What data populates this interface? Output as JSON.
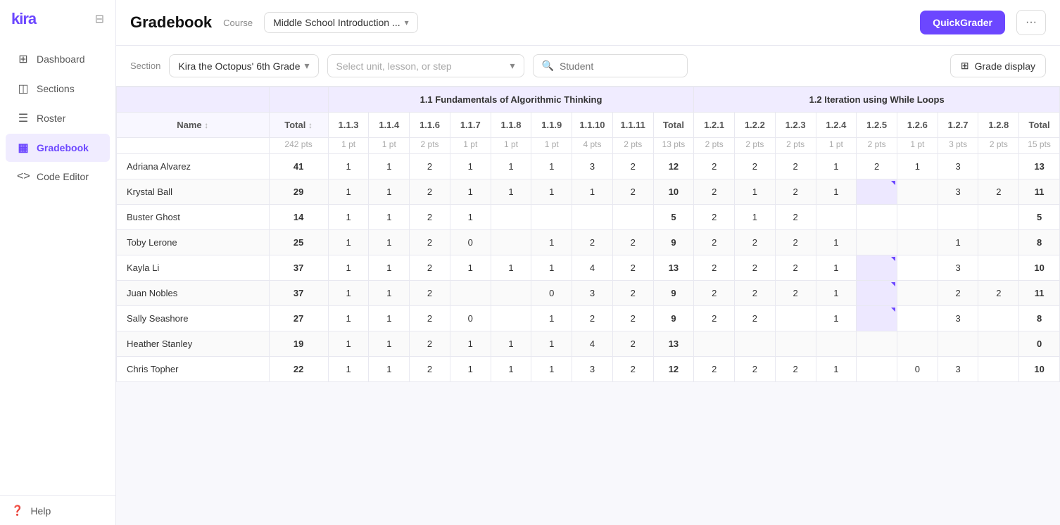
{
  "app": {
    "name": "kira"
  },
  "sidebar": {
    "items": [
      {
        "id": "dashboard",
        "label": "Dashboard",
        "icon": "⊞",
        "active": false
      },
      {
        "id": "sections",
        "label": "Sections",
        "icon": "◫",
        "active": false
      },
      {
        "id": "roster",
        "label": "Roster",
        "icon": "☰",
        "active": false
      },
      {
        "id": "gradebook",
        "label": "Gradebook",
        "icon": "▦",
        "active": true
      },
      {
        "id": "code-editor",
        "label": "Code Editor",
        "icon": "<>",
        "active": false
      }
    ],
    "footer": {
      "label": "Help"
    }
  },
  "header": {
    "title": "Gradebook",
    "course_label": "Course",
    "course_name": "Middle School Introduction ...",
    "quick_grader_label": "QuickGrader",
    "more_label": "···"
  },
  "toolbar": {
    "section_label": "Section",
    "section_name": "Kira the Octopus' 6th Grade",
    "unit_placeholder": "Select unit, lesson, or step",
    "search_placeholder": "Student",
    "grade_display_label": "Grade display"
  },
  "table": {
    "name_col": "Name",
    "total_col": "Total",
    "total_pts": "242 pts",
    "groups": [
      {
        "name": "1.1 Fundamentals of Algorithmic Thinking",
        "cols": [
          {
            "id": "1.1.3",
            "pts": "1 pt"
          },
          {
            "id": "1.1.4",
            "pts": "1 pt"
          },
          {
            "id": "1.1.6",
            "pts": "2 pts"
          },
          {
            "id": "1.1.7",
            "pts": "1 pt"
          },
          {
            "id": "1.1.8",
            "pts": "1 pt"
          },
          {
            "id": "1.1.9",
            "pts": "1 pt"
          },
          {
            "id": "1.1.10",
            "pts": "4 pts"
          },
          {
            "id": "1.1.11",
            "pts": "2 pts"
          },
          {
            "id": "Total",
            "pts": "13 pts"
          }
        ]
      },
      {
        "name": "1.2 Iteration using While Loops",
        "cols": [
          {
            "id": "1.2.1",
            "pts": "2 pts"
          },
          {
            "id": "1.2.2",
            "pts": "2 pts"
          },
          {
            "id": "1.2.3",
            "pts": "2 pts"
          },
          {
            "id": "1.2.4",
            "pts": "1 pt"
          },
          {
            "id": "1.2.5",
            "pts": "2 pts"
          },
          {
            "id": "1.2.6",
            "pts": "1 pt"
          },
          {
            "id": "1.2.7",
            "pts": "3 pts"
          },
          {
            "id": "1.2.8",
            "pts": "2 pts"
          },
          {
            "id": "Total",
            "pts": "15 pts"
          }
        ]
      }
    ],
    "students": [
      {
        "name": "Adriana Alvarez",
        "total": "41",
        "g1": [
          "1",
          "1",
          "2",
          "1",
          "1",
          "1",
          "3",
          "2",
          "12"
        ],
        "g2": [
          "2",
          "2",
          "2",
          "1",
          "2",
          "1",
          "3",
          "",
          "13"
        ],
        "highlights": []
      },
      {
        "name": "Krystal Ball",
        "total": "29",
        "g1": [
          "1",
          "1",
          "2",
          "1",
          "1",
          "1",
          "1",
          "2",
          "10"
        ],
        "g2": [
          "2",
          "1",
          "2",
          "1",
          "",
          "",
          "3",
          "2",
          "11"
        ],
        "highlights": [
          "1.2.5"
        ]
      },
      {
        "name": "Buster Ghost",
        "total": "14",
        "g1": [
          "1",
          "1",
          "2",
          "1",
          "",
          "",
          "",
          "",
          "5"
        ],
        "g2": [
          "2",
          "1",
          "2",
          "",
          "",
          "",
          "",
          "",
          "5"
        ],
        "highlights": []
      },
      {
        "name": "Toby Lerone",
        "total": "25",
        "g1": [
          "1",
          "1",
          "2",
          "0",
          "",
          "1",
          "2",
          "2",
          "9"
        ],
        "g2": [
          "2",
          "2",
          "2",
          "1",
          "",
          "",
          "1",
          "",
          "8"
        ],
        "highlights": []
      },
      {
        "name": "Kayla Li",
        "total": "37",
        "g1": [
          "1",
          "1",
          "2",
          "1",
          "1",
          "1",
          "4",
          "2",
          "13"
        ],
        "g2": [
          "2",
          "2",
          "2",
          "1",
          "",
          "",
          "3",
          "",
          "10"
        ],
        "highlights": [
          "1.2.5"
        ]
      },
      {
        "name": "Juan Nobles",
        "total": "37",
        "g1": [
          "1",
          "1",
          "2",
          "",
          "",
          "0",
          "3",
          "2",
          "9"
        ],
        "g2": [
          "2",
          "2",
          "2",
          "1",
          "",
          "",
          "2",
          "2",
          "11"
        ],
        "highlights": [
          "1.2.5"
        ]
      },
      {
        "name": "Sally Seashore",
        "total": "27",
        "g1": [
          "1",
          "1",
          "2",
          "0",
          "",
          "1",
          "2",
          "2",
          "9"
        ],
        "g2": [
          "2",
          "2",
          "",
          "1",
          "",
          "",
          "3",
          "",
          "8"
        ],
        "highlights": [
          "1.2.5"
        ]
      },
      {
        "name": "Heather Stanley",
        "total": "19",
        "g1": [
          "1",
          "1",
          "2",
          "1",
          "1",
          "1",
          "4",
          "2",
          "13"
        ],
        "g2": [
          "",
          "",
          "",
          "",
          "",
          "",
          "",
          "",
          "0"
        ],
        "highlights": []
      },
      {
        "name": "Chris Topher",
        "total": "22",
        "g1": [
          "1",
          "1",
          "2",
          "1",
          "1",
          "1",
          "3",
          "2",
          "12"
        ],
        "g2": [
          "2",
          "2",
          "2",
          "1",
          "",
          "0",
          "3",
          "",
          "10"
        ],
        "highlights": []
      }
    ]
  }
}
